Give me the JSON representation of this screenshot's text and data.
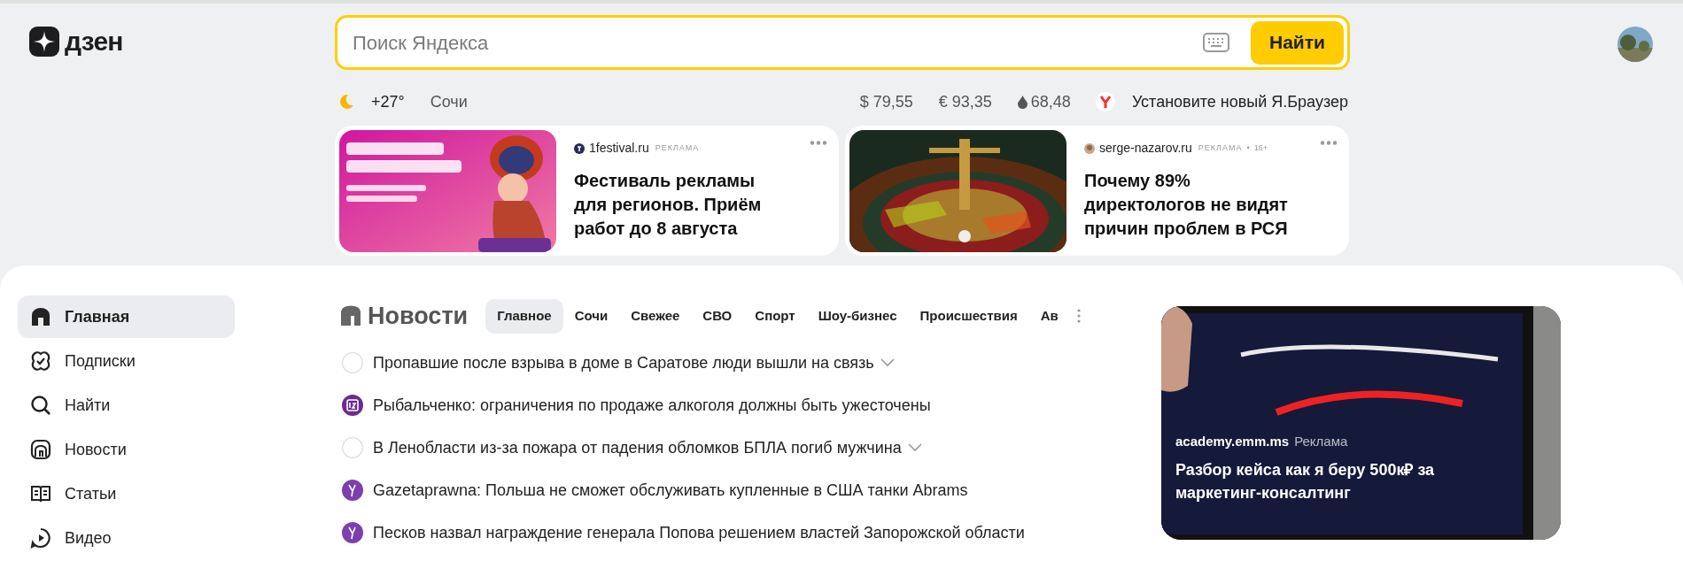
{
  "logo": {
    "text": "дзен"
  },
  "search": {
    "placeholder": "Поиск Яндекса",
    "button": "Найти"
  },
  "info_bar": {
    "temperature": "+27°",
    "city": "Сочи",
    "rates": [
      {
        "kind": "usd",
        "value": "$ 79,55"
      },
      {
        "kind": "eur",
        "value": "€ 93,35"
      },
      {
        "kind": "oil",
        "value": "68,48"
      }
    ],
    "promo": "Установите новый Я.Браузер"
  },
  "ads": [
    {
      "source": "1festival.ru",
      "label": "РЕКЛАМА",
      "title": "Фестиваль рекламы для регионов. Приём работ до 8 августа",
      "kind": "picture"
    },
    {
      "source": "serge-nazarov.ru",
      "label": "РЕКЛАМА",
      "separator": "•",
      "age": "16+",
      "title": "Почему 89% директологов не видят причин проблем в РСЯ",
      "kind": "picture"
    }
  ],
  "sidebar": {
    "items": [
      {
        "label": "Главная",
        "selected": true
      },
      {
        "label": "Подписки",
        "selected": false
      },
      {
        "label": "Найти",
        "selected": false
      },
      {
        "label": "Новости",
        "selected": false
      },
      {
        "label": "Статьи",
        "selected": false
      },
      {
        "label": "Видео",
        "selected": false
      }
    ]
  },
  "news": {
    "title": "Новости",
    "tabs": [
      {
        "label": "Главное",
        "selected": true
      },
      {
        "label": "Сочи",
        "selected": false
      },
      {
        "label": "Свежее",
        "selected": false
      },
      {
        "label": "СВО",
        "selected": false
      },
      {
        "label": "Спорт",
        "selected": false
      },
      {
        "label": "Шоу-бизнес",
        "selected": false
      },
      {
        "label": "Происшествия",
        "selected": false
      },
      {
        "label": "Ав",
        "selected": false
      }
    ],
    "items": [
      {
        "text": "Пропавшие после взрыва в доме в Саратове люди вышли на связь",
        "kind": "blank",
        "expandable": true
      },
      {
        "text": "Рыбальченко: ограничения по продаже алкоголя должны быть ужесточены",
        "kind": "iz",
        "expandable": false
      },
      {
        "text": "В Ленобласти из-за пожара от падения обломков БПЛА погиб мужчина",
        "kind": "blank",
        "expandable": true
      },
      {
        "text": "Gazetaprawna: Польша не сможет обслуживать купленные в США танки Abrams",
        "kind": "y",
        "expandable": false
      },
      {
        "text": "Песков назвал награждение генерала Попова решением властей Запорожской области",
        "kind": "y",
        "expandable": false
      }
    ]
  },
  "promo_card": {
    "source": "academy.emm.ms",
    "label": "Реклама",
    "title": "Разбор кейса как я беру 500к₽ за маркетинг-консалтинг",
    "kind": "picture"
  }
}
